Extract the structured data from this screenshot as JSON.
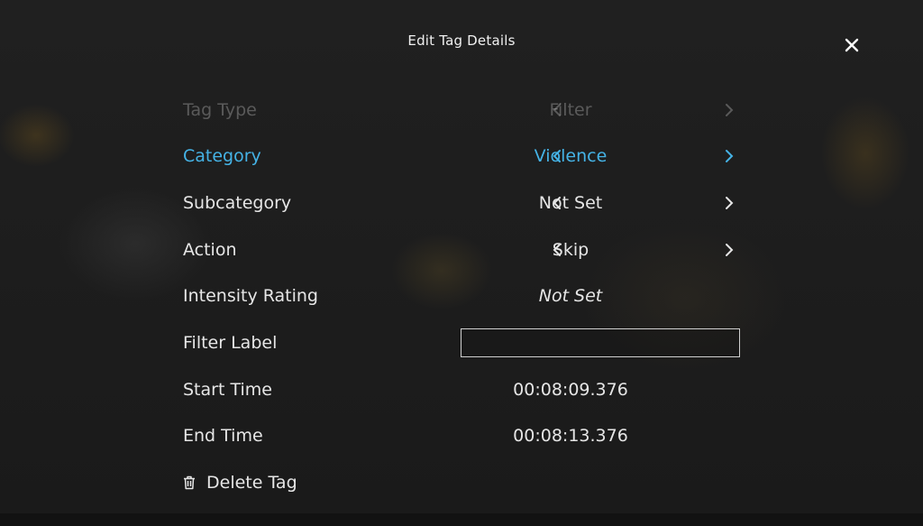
{
  "dialog": {
    "title": "Edit Tag Details",
    "close_icon": "close-icon"
  },
  "fields": {
    "tag_type": {
      "label": "Tag Type",
      "value": "Filter"
    },
    "category": {
      "label": "Category",
      "value": "Violence"
    },
    "subcategory": {
      "label": "Subcategory",
      "value": "Not Set"
    },
    "action": {
      "label": "Action",
      "value": "Skip"
    },
    "intensity_rating": {
      "label": "Intensity Rating",
      "value": "Not Set"
    },
    "filter_label": {
      "label": "Filter Label",
      "value": ""
    },
    "start_time": {
      "label": "Start Time",
      "value": "00:08:09.376"
    },
    "end_time": {
      "label": "End Time",
      "value": "00:08:13.376"
    }
  },
  "delete": {
    "label": "Delete Tag",
    "icon": "trash-icon"
  },
  "colors": {
    "accent": "#45b3e6",
    "text": "#e6e6e6",
    "background": "#1b1b1b"
  }
}
